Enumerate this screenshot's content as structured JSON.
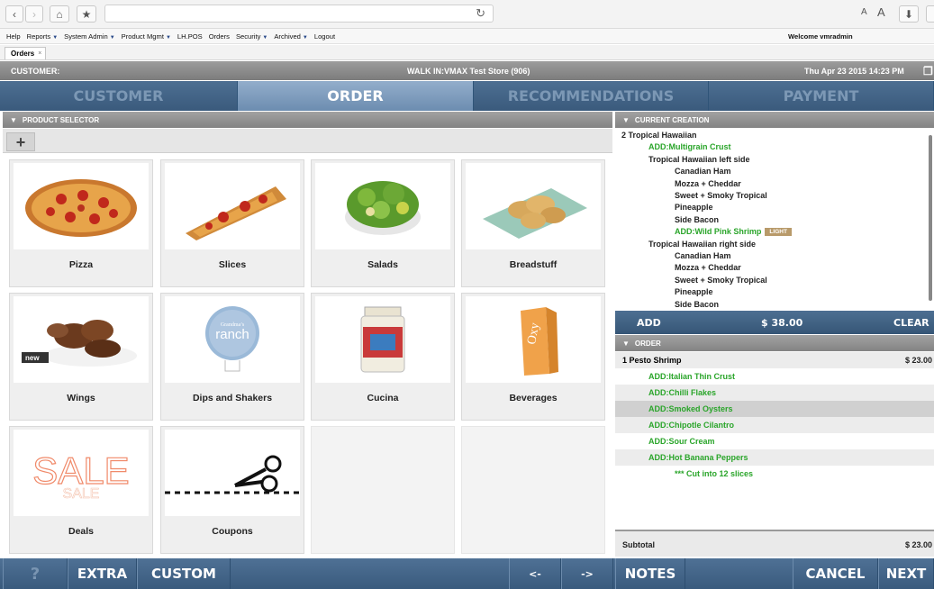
{
  "browser": {
    "back_icon": "chevron-left-icon",
    "forward_icon": "chevron-right-icon",
    "home_icon": "home-icon",
    "bookmark_icon": "bookmark-star-icon",
    "reload_icon": "reload-icon",
    "text_small": "A",
    "text_large": "A",
    "download_icon": "download-icon"
  },
  "menu": {
    "items": [
      {
        "label": "Help",
        "dropdown": false
      },
      {
        "label": "Reports",
        "dropdown": true
      },
      {
        "label": "System Admin",
        "dropdown": true
      },
      {
        "label": "Product Mgmt",
        "dropdown": true
      },
      {
        "label": "LH.POS",
        "dropdown": false
      },
      {
        "label": "Orders",
        "dropdown": false
      },
      {
        "label": "Security",
        "dropdown": true
      },
      {
        "label": "Archived",
        "dropdown": true
      },
      {
        "label": "Logout",
        "dropdown": false
      }
    ],
    "welcome": "Welcome vmradmin"
  },
  "tab": {
    "label": "Orders",
    "close": "×"
  },
  "customer_bar": {
    "label": "CUSTOMER:",
    "store": "WALK IN:VMAX Test Store (906)",
    "datetime": "Thu Apr 23 2015 14:23 PM"
  },
  "steps": [
    {
      "label": "CUSTOMER",
      "active": false
    },
    {
      "label": "ORDER",
      "active": true
    },
    {
      "label": "RECOMMENDATIONS",
      "active": false
    },
    {
      "label": "PAYMENT",
      "active": false
    }
  ],
  "product_selector": {
    "title": "PRODUCT SELECTOR",
    "add_symbol": "+",
    "tiles": [
      {
        "label": "Pizza",
        "icon": "pizza-image"
      },
      {
        "label": "Slices",
        "icon": "pizza-slice-image"
      },
      {
        "label": "Salads",
        "icon": "salad-image"
      },
      {
        "label": "Breadstuff",
        "icon": "breadstuff-image"
      },
      {
        "label": "Wings",
        "icon": "wings-image",
        "badge": "new"
      },
      {
        "label": "Dips and Shakers",
        "icon": "ranch-image",
        "badge": "ranch"
      },
      {
        "label": "Cucina",
        "icon": "jar-image"
      },
      {
        "label": "Beverages",
        "icon": "beverage-box-image"
      },
      {
        "label": "Deals",
        "icon": "sale-image",
        "badge": "SALE"
      },
      {
        "label": "Coupons",
        "icon": "scissors-image"
      },
      {
        "label": "",
        "icon": ""
      },
      {
        "label": "",
        "icon": ""
      }
    ]
  },
  "current_creation": {
    "title": "CURRENT CREATION",
    "lines": [
      {
        "text": "2   Tropical Hawaiian",
        "indent": 0,
        "green": false
      },
      {
        "text": "ADD:Multigrain Crust",
        "indent": 1,
        "green": true
      },
      {
        "text": "Tropical Hawaiian left side",
        "indent": 1,
        "green": false
      },
      {
        "text": "Canadian Ham",
        "indent": 2,
        "green": false
      },
      {
        "text": "Mozza + Cheddar",
        "indent": 2,
        "green": false
      },
      {
        "text": "Sweet + Smoky Tropical",
        "indent": 2,
        "green": false
      },
      {
        "text": "Pineapple",
        "indent": 2,
        "green": false
      },
      {
        "text": "Side Bacon",
        "indent": 2,
        "green": false
      },
      {
        "text": "ADD:Wild Pink Shrimp",
        "indent": 2,
        "green": true,
        "badge": "LIGHT"
      },
      {
        "text": "Tropical Hawaiian right side",
        "indent": 1,
        "green": false
      },
      {
        "text": "Canadian Ham",
        "indent": 2,
        "green": false
      },
      {
        "text": "Mozza + Cheddar",
        "indent": 2,
        "green": false
      },
      {
        "text": "Sweet + Smoky Tropical",
        "indent": 2,
        "green": false
      },
      {
        "text": "Pineapple",
        "indent": 2,
        "green": false
      },
      {
        "text": "Side Bacon",
        "indent": 2,
        "green": false
      }
    ],
    "add": "ADD",
    "total": "$ 38.00",
    "clear": "CLEAR"
  },
  "order": {
    "title": "ORDER",
    "lines": [
      {
        "text": "1    Pesto Shrimp",
        "price": "$ 23.00",
        "green": false,
        "indent": 0,
        "style": "shaded"
      },
      {
        "text": "ADD:Italian Thin Crust",
        "green": true,
        "indent": 1,
        "style": "plain"
      },
      {
        "text": "ADD:Chilli Flakes",
        "green": true,
        "indent": 1,
        "style": "shaded"
      },
      {
        "text": "ADD:Smoked Oysters",
        "green": true,
        "indent": 1,
        "style": "highlight"
      },
      {
        "text": "ADD:Chipotle Cilantro",
        "green": true,
        "indent": 1,
        "style": "shaded"
      },
      {
        "text": "ADD:Sour Cream",
        "green": true,
        "indent": 1,
        "style": "plain"
      },
      {
        "text": "ADD:Hot Banana Peppers",
        "green": true,
        "indent": 1,
        "style": "shaded"
      },
      {
        "text": "*** Cut into 12 slices",
        "green": true,
        "indent": 2,
        "style": "plain"
      }
    ],
    "subtotal_label": "Subtotal",
    "subtotal_value": "$ 23.00"
  },
  "bottom": {
    "help": "?",
    "extra": "EXTRA",
    "custom": "CUSTOM",
    "prev": "<-",
    "next_page": "->",
    "notes": "NOTES",
    "cancel": "CANCEL",
    "next": "NEXT"
  }
}
